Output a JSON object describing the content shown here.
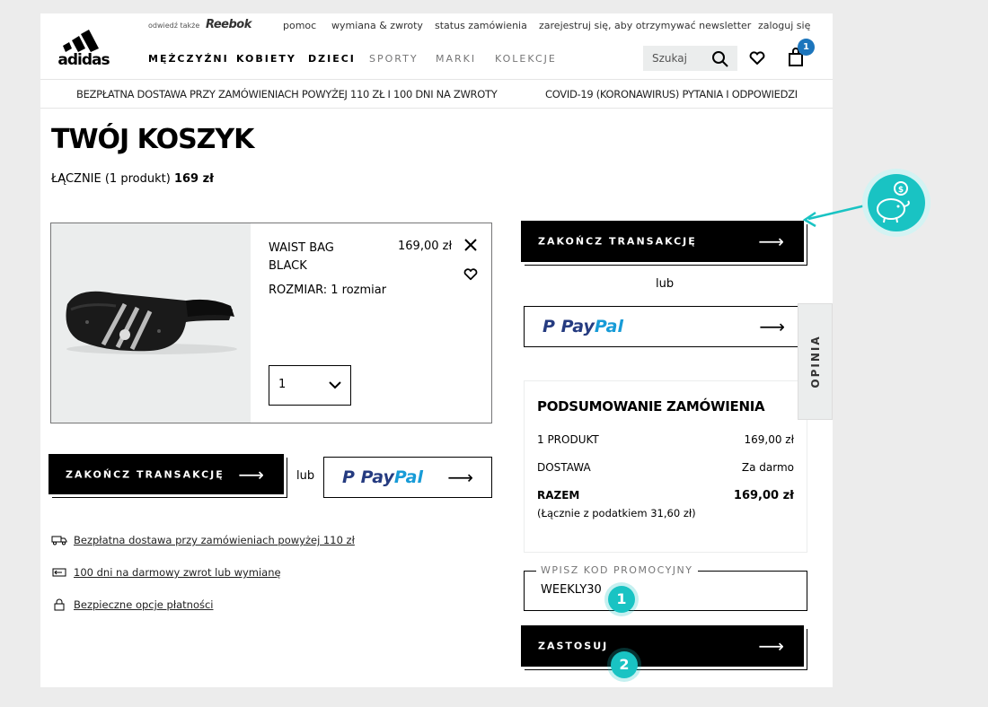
{
  "top_links": {
    "visit_also": "odwiedź także",
    "reebok": "Reebok",
    "help": "pomoc",
    "returns": "wymiana & zwroty",
    "order_status": "status zamówienia",
    "newsletter": "zarejestruj się, aby otrzymywać newsletter",
    "login": "zaloguj się"
  },
  "logo_text": "adidas",
  "nav": {
    "men": "MĘŻCZYŹNI",
    "women": "KOBIETY",
    "kids": "DZIECI",
    "sports": "SPORTY",
    "brands": "MARKI",
    "collections": "KOLEKCJE"
  },
  "search": {
    "placeholder": "Szukaj"
  },
  "cart_count": "1",
  "banner": {
    "left": "BEZPŁATNA DOSTAWA PRZY ZAMÓWIENIACH POWYŻEJ 110 ZŁ I 100 DNI NA ZWROTY",
    "right": "COVID-19 (KORONAWIRUS) PYTANIA I ODPOWIEDZI"
  },
  "page_title": "TWÓJ KOSZYK",
  "total": {
    "label": "ŁĄCZNIE (1 produkt)",
    "value": "169 zł"
  },
  "item": {
    "name_line1": "WAIST BAG",
    "name_line2": "BLACK",
    "price": "169,00 zł",
    "size": "ROZMIAR: 1 rozmiar",
    "quantity": "1"
  },
  "checkout_label": "ZAKOŃCZ TRANSAKCJĘ",
  "or_label": "lub",
  "paypal": {
    "pay": "Pay",
    "pal": "Pal"
  },
  "summary": {
    "title": "PODSUMOWANIE ZAMÓWIENIA",
    "products_label": "1 PRODUKT",
    "products_value": "169,00 zł",
    "delivery_label": "DOSTAWA",
    "delivery_value": "Za darmo",
    "total_label": "RAZEM",
    "total_value": "169,00 zł",
    "tax_note": "(Łącznie z podatkiem  31,60 zł)"
  },
  "promo": {
    "legend": "WPISZ KOD PROMOCYJNY",
    "value": "WEEKLY30"
  },
  "apply_label": "ZASTOSUJ",
  "benefits": {
    "delivery": "Bezpłatna dostawa przy zamówieniach powyżej 110 zł",
    "returns": "100 dni na darmowy zwrot lub wymianę",
    "payment": "Bezpieczne opcje płatności"
  },
  "feedback_tab": "OPINIA",
  "annotations": {
    "step1": "1",
    "step2": "2"
  },
  "colors": {
    "accent": "#19c3c3",
    "paypal_dark": "#253b80",
    "paypal_light": "#179bd7",
    "badge_blue": "#1c75bc"
  }
}
